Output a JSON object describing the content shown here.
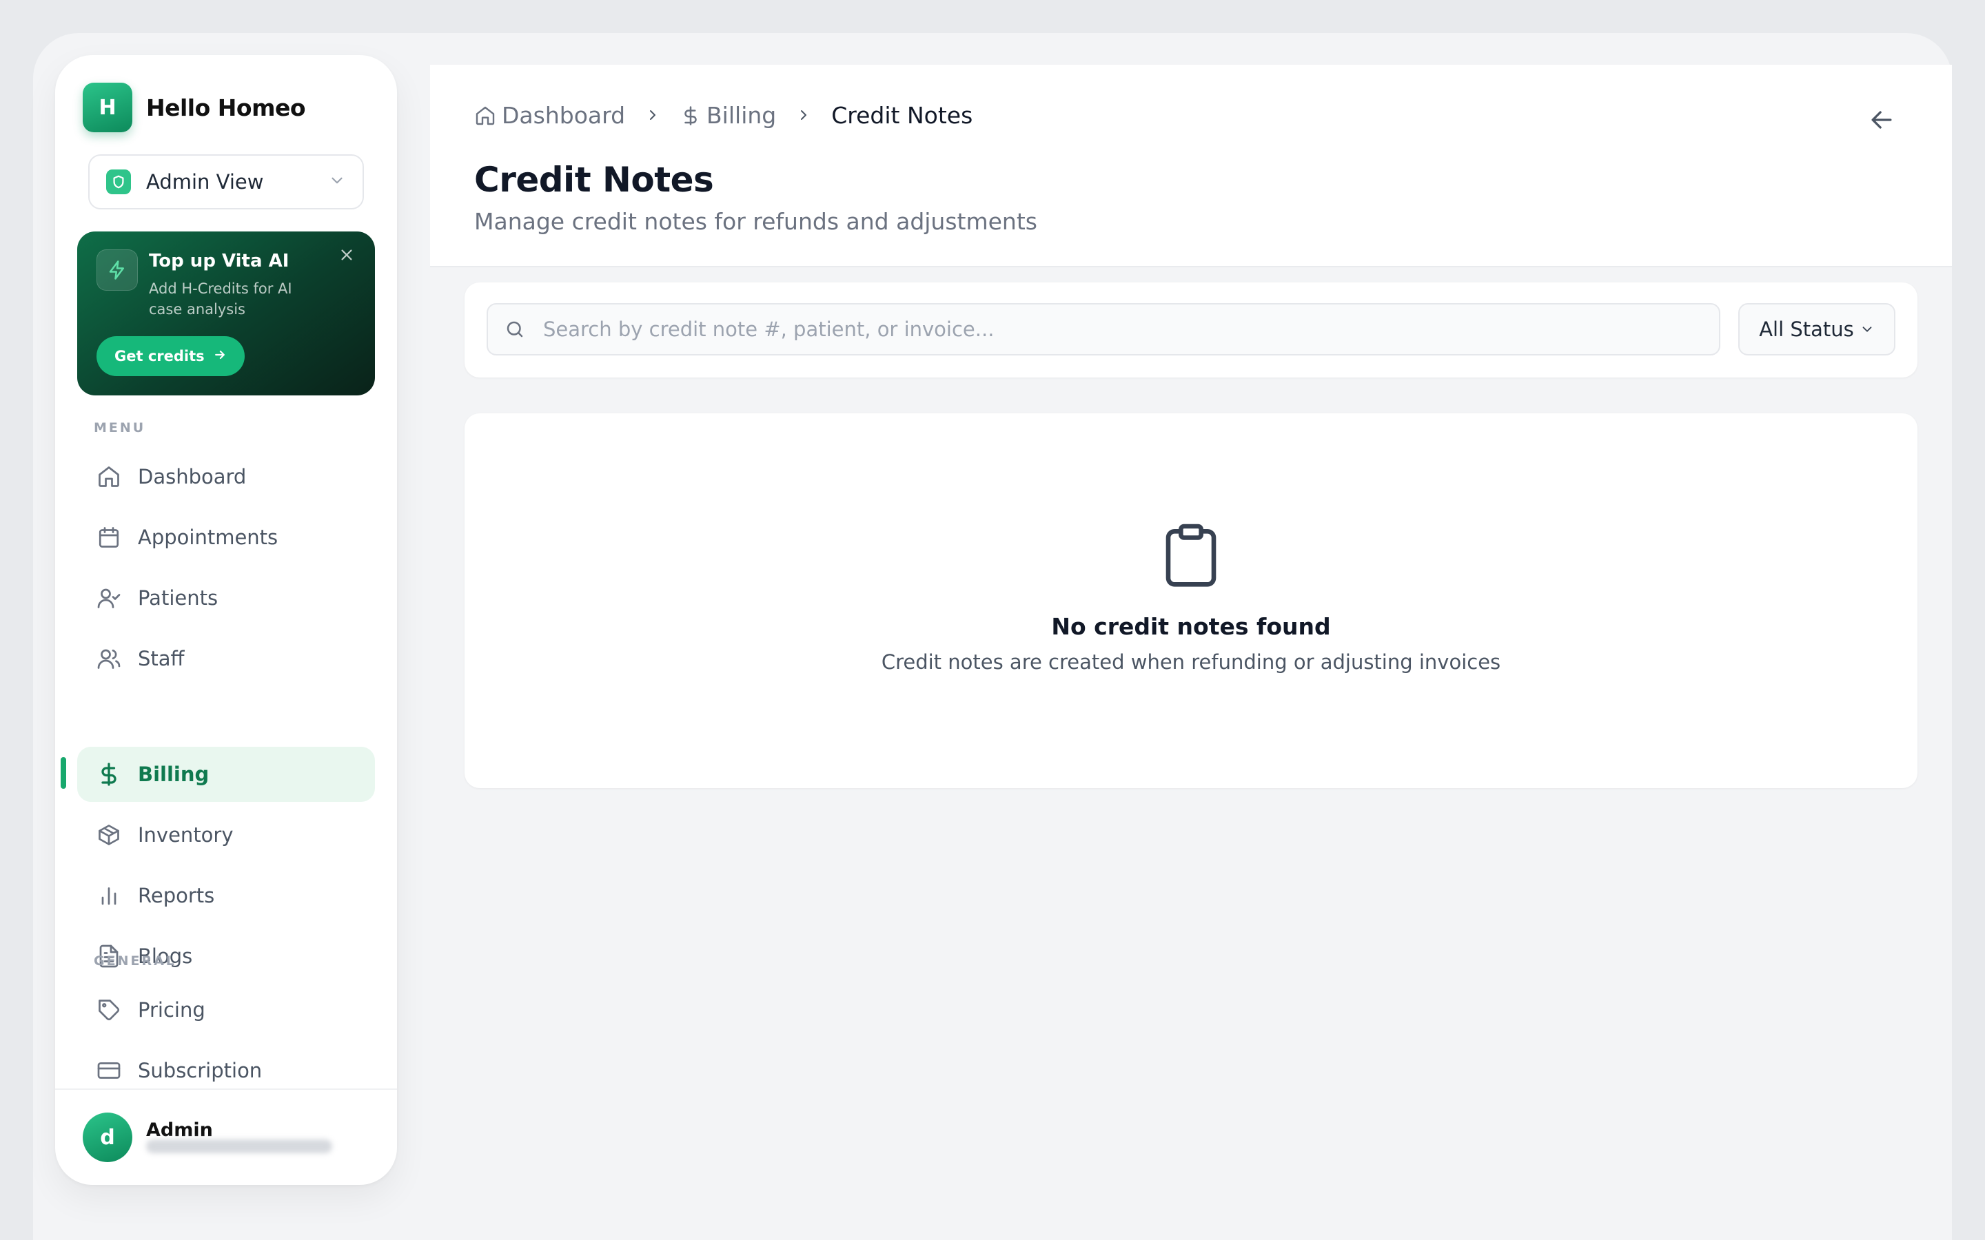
{
  "brand": {
    "logo_letter": "H",
    "name": "Hello Homeo"
  },
  "view_selector": {
    "label": "Admin View",
    "icon": "shield-icon"
  },
  "promo": {
    "title": "Top up Vita AI",
    "description": "Add H-Credits for AI case analysis",
    "button_label": "Get credits",
    "icon": "lightning-icon"
  },
  "sidebar": {
    "menu_label": "MENU",
    "menu_items": [
      {
        "label": "Dashboard",
        "icon": "home-icon",
        "active": false
      },
      {
        "label": "Appointments",
        "icon": "calendar-icon",
        "active": false
      },
      {
        "label": "Patients",
        "icon": "user-check-icon",
        "active": false
      },
      {
        "label": "Staff",
        "icon": "users-icon",
        "active": false
      },
      {
        "label": "Billing",
        "icon": "dollar-icon",
        "active": true
      },
      {
        "label": "Inventory",
        "icon": "package-icon",
        "active": false
      },
      {
        "label": "Reports",
        "icon": "bar-chart-icon",
        "active": false
      },
      {
        "label": "Blogs",
        "icon": "file-text-icon",
        "active": false
      }
    ],
    "general_label": "GENERAL",
    "general_items": [
      {
        "label": "Pricing",
        "icon": "tag-icon"
      },
      {
        "label": "Subscription",
        "icon": "credit-card-icon"
      }
    ]
  },
  "user": {
    "avatar_letter": "d",
    "name": "Admin"
  },
  "breadcrumb": {
    "items": [
      "Dashboard",
      "Billing",
      "Credit Notes"
    ]
  },
  "page": {
    "title": "Credit Notes",
    "subtitle": "Manage credit notes for refunds and adjustments"
  },
  "filters": {
    "search_placeholder": "Search by credit note #, patient, or invoice...",
    "status_selected": "All Status"
  },
  "empty_state": {
    "title": "No credit notes found",
    "description": "Credit notes are created when refunding or adjusting invoices",
    "icon": "clipboard-icon"
  },
  "colors": {
    "accent": "#16b87a",
    "active_bg": "#e9f7ef",
    "active_text": "#0f7a4f",
    "promo_bg": "#0b3f2c"
  }
}
